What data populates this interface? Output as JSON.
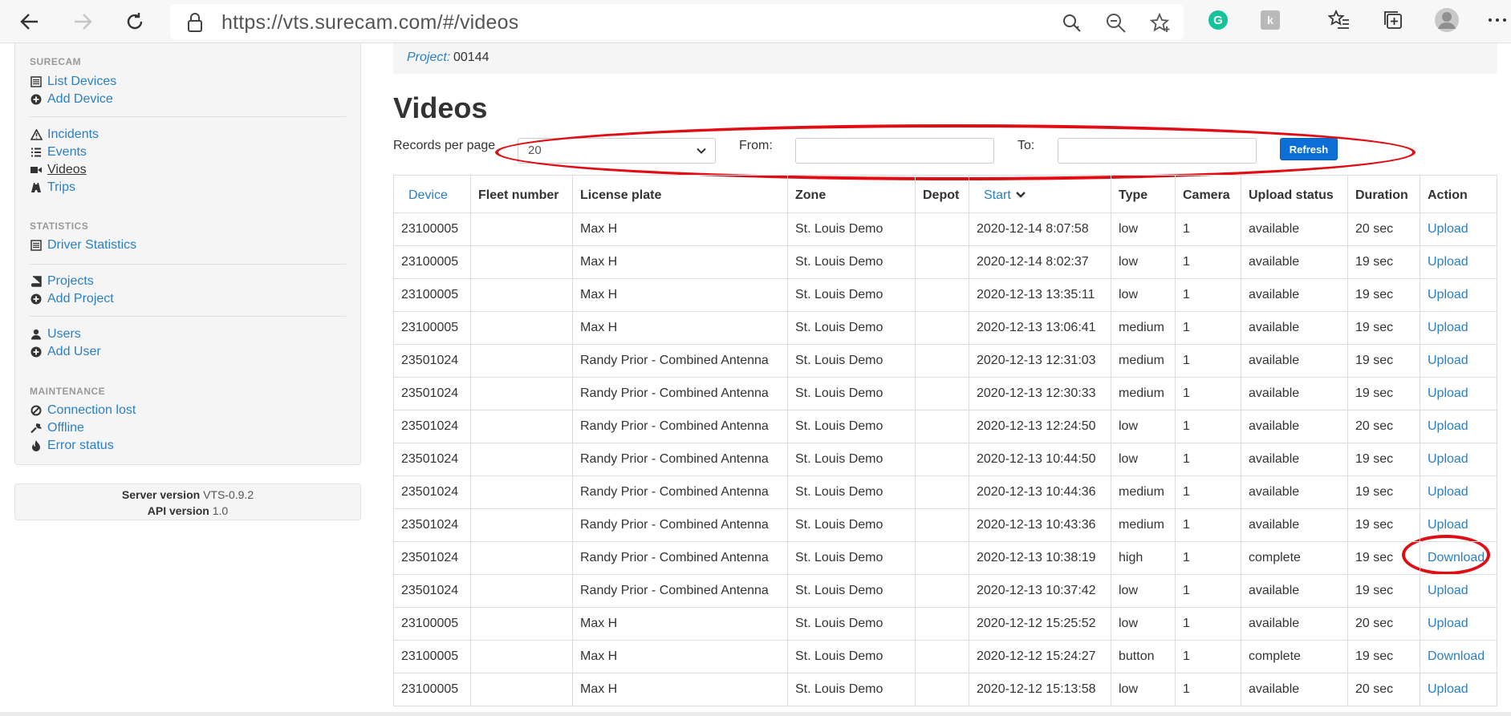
{
  "browser": {
    "url": "https://vts.surecam.com/#/videos"
  },
  "sidebar": {
    "sections": [
      {
        "header": "SURECAM",
        "items": [
          {
            "label": "List Devices",
            "icon": "list-icon"
          },
          {
            "label": "Add Device",
            "icon": "plus-circle-icon"
          }
        ]
      },
      {
        "header": "",
        "items": [
          {
            "label": "Incidents",
            "icon": "warning-icon"
          },
          {
            "label": "Events",
            "icon": "list-lines-icon"
          },
          {
            "label": "Videos",
            "icon": "video-camera-icon",
            "active": true
          },
          {
            "label": "Trips",
            "icon": "road-icon"
          }
        ]
      },
      {
        "header": "STATISTICS",
        "items": [
          {
            "label": "Driver Statistics",
            "icon": "list-icon"
          }
        ]
      },
      {
        "header": "",
        "items": [
          {
            "label": "Projects",
            "icon": "book-icon"
          },
          {
            "label": "Add Project",
            "icon": "plus-circle-icon"
          }
        ]
      },
      {
        "header": "",
        "items": [
          {
            "label": "Users",
            "icon": "user-icon"
          },
          {
            "label": "Add User",
            "icon": "plus-circle-icon"
          }
        ]
      },
      {
        "header": "MAINTENANCE",
        "items": [
          {
            "label": "Connection lost",
            "icon": "ban-icon"
          },
          {
            "label": "Offline",
            "icon": "wrench-icon"
          },
          {
            "label": "Error status",
            "icon": "fire-icon"
          }
        ]
      }
    ]
  },
  "version": {
    "server_label": "Server version",
    "server_value": "VTS-0.9.2",
    "api_label": "API version",
    "api_value": "1.0"
  },
  "project": {
    "label": "Project:",
    "value": "00144"
  },
  "page": {
    "title": "Videos"
  },
  "filters": {
    "records_label": "Records per page",
    "records_value": "20",
    "from_label": "From:",
    "to_label": "To:",
    "refresh_label": "Refresh"
  },
  "table": {
    "columns": [
      "Device",
      "Fleet number",
      "License plate",
      "Zone",
      "Depot",
      "Start",
      "Type",
      "Camera",
      "Upload status",
      "Duration",
      "Action"
    ],
    "rows": [
      [
        "23100005",
        "",
        "Max H",
        "St. Louis Demo",
        "",
        "2020-12-14 8:07:58",
        "low",
        "1",
        "available",
        "20 sec",
        "Upload"
      ],
      [
        "23100005",
        "",
        "Max H",
        "St. Louis Demo",
        "",
        "2020-12-14 8:02:37",
        "low",
        "1",
        "available",
        "19 sec",
        "Upload"
      ],
      [
        "23100005",
        "",
        "Max H",
        "St. Louis Demo",
        "",
        "2020-12-13 13:35:11",
        "low",
        "1",
        "available",
        "19 sec",
        "Upload"
      ],
      [
        "23100005",
        "",
        "Max H",
        "St. Louis Demo",
        "",
        "2020-12-13 13:06:41",
        "medium",
        "1",
        "available",
        "19 sec",
        "Upload"
      ],
      [
        "23501024",
        "",
        "Randy Prior - Combined Antenna",
        "St. Louis Demo",
        "",
        "2020-12-13 12:31:03",
        "medium",
        "1",
        "available",
        "19 sec",
        "Upload"
      ],
      [
        "23501024",
        "",
        "Randy Prior - Combined Antenna",
        "St. Louis Demo",
        "",
        "2020-12-13 12:30:33",
        "medium",
        "1",
        "available",
        "19 sec",
        "Upload"
      ],
      [
        "23501024",
        "",
        "Randy Prior - Combined Antenna",
        "St. Louis Demo",
        "",
        "2020-12-13 12:24:50",
        "low",
        "1",
        "available",
        "20 sec",
        "Upload"
      ],
      [
        "23501024",
        "",
        "Randy Prior - Combined Antenna",
        "St. Louis Demo",
        "",
        "2020-12-13 10:44:50",
        "low",
        "1",
        "available",
        "19 sec",
        "Upload"
      ],
      [
        "23501024",
        "",
        "Randy Prior - Combined Antenna",
        "St. Louis Demo",
        "",
        "2020-12-13 10:44:36",
        "medium",
        "1",
        "available",
        "19 sec",
        "Upload"
      ],
      [
        "23501024",
        "",
        "Randy Prior - Combined Antenna",
        "St. Louis Demo",
        "",
        "2020-12-13 10:43:36",
        "medium",
        "1",
        "available",
        "19 sec",
        "Upload"
      ],
      [
        "23501024",
        "",
        "Randy Prior - Combined Antenna",
        "St. Louis Demo",
        "",
        "2020-12-13 10:38:19",
        "high",
        "1",
        "complete",
        "19 sec",
        "Download"
      ],
      [
        "23501024",
        "",
        "Randy Prior - Combined Antenna",
        "St. Louis Demo",
        "",
        "2020-12-13 10:37:42",
        "low",
        "1",
        "available",
        "19 sec",
        "Upload"
      ],
      [
        "23100005",
        "",
        "Max H",
        "St. Louis Demo",
        "",
        "2020-12-12 15:25:52",
        "low",
        "1",
        "available",
        "20 sec",
        "Upload"
      ],
      [
        "23100005",
        "",
        "Max H",
        "St. Louis Demo",
        "",
        "2020-12-12 15:24:27",
        "button",
        "1",
        "complete",
        "19 sec",
        "Download"
      ],
      [
        "23100005",
        "",
        "Max H",
        "St. Louis Demo",
        "",
        "2020-12-12 15:13:58",
        "low",
        "1",
        "available",
        "20 sec",
        "Upload"
      ]
    ]
  },
  "colors": {
    "link": "#2a7fc4",
    "button": "#0d6fd6",
    "annotation": "#e10d15"
  }
}
